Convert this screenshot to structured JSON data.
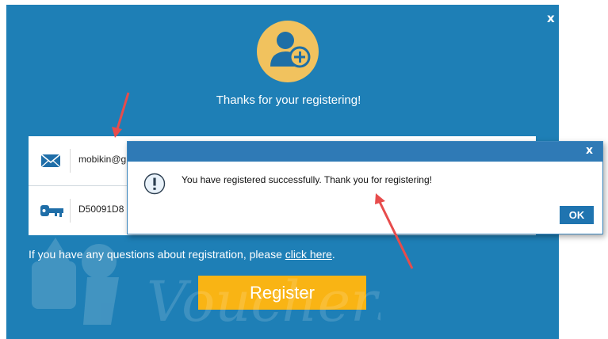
{
  "registration": {
    "thanks_text": "Thanks for your registering!",
    "email_value": "mobikin@g",
    "code_value": "D50091D8",
    "help_text": "If you have any questions about registration, please ",
    "help_link": "click here",
    "help_suffix": ".",
    "register_label": "Register",
    "close_label": "x"
  },
  "message_box": {
    "text": "You have registered successfully. Thank you for registering!",
    "ok_label": "OK",
    "close_label": "x"
  },
  "watermark": {
    "text": "Vouchers"
  },
  "colors": {
    "dialog_bg": "#1e7fb6",
    "avatar_bg": "#f1c25e",
    "register_button": "#f9b414",
    "annotation_arrow": "#e74c4c"
  },
  "icons": [
    "close-icon",
    "add-user-icon",
    "email-icon",
    "key-icon",
    "info-icon"
  ]
}
